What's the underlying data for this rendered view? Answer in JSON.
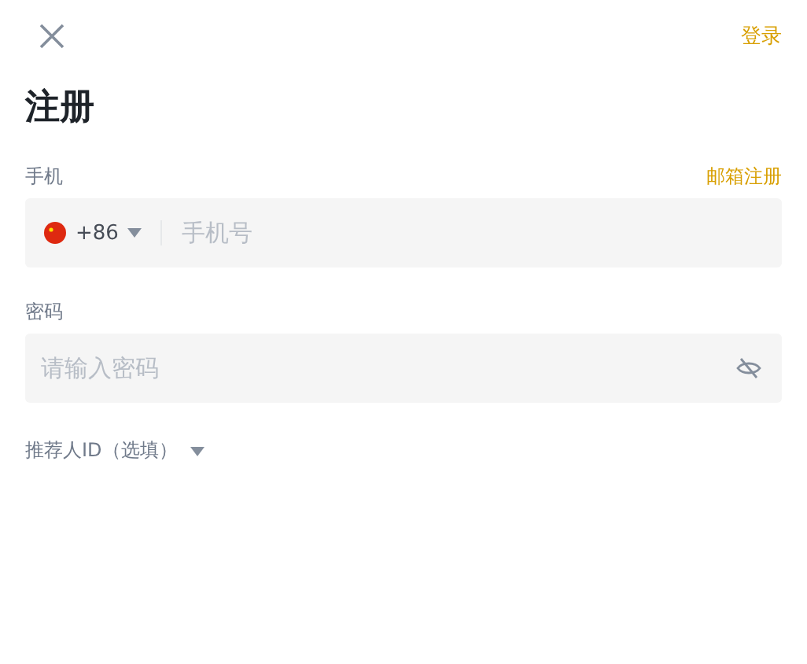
{
  "header": {
    "login_link": "登录"
  },
  "title": "注册",
  "phone": {
    "label": "手机",
    "switch_link": "邮箱注册",
    "country_code": "+86",
    "placeholder": "手机号"
  },
  "password": {
    "label": "密码",
    "placeholder": "请输入密码"
  },
  "referral": {
    "label": "推荐人ID（选填）"
  }
}
